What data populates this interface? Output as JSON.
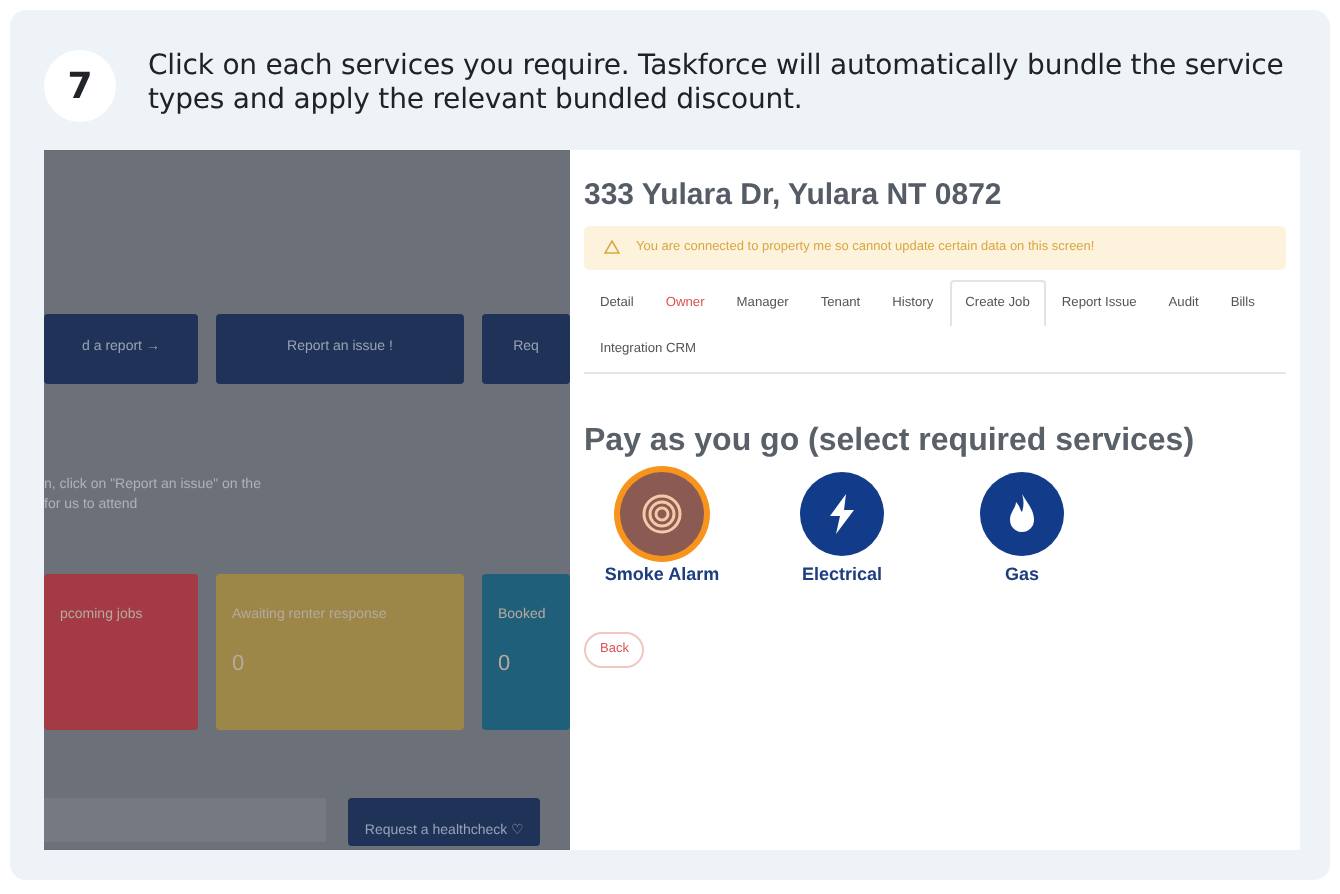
{
  "step": {
    "number": "7",
    "instruction": "Click on each services you require. Taskforce will automatically bundle the service types and apply the relevant bundled discount."
  },
  "background_page": {
    "buttons": [
      {
        "label": "d a report →"
      },
      {
        "label": "Report an issue !"
      },
      {
        "label": "Req"
      }
    ],
    "text_lines": [
      "n, click on \"Report an issue\" on the",
      "for us to attend"
    ],
    "stat_cards": [
      {
        "label": "pcoming jobs",
        "color": "#a33a44"
      },
      {
        "label": "Awaiting renter response",
        "value": "0",
        "color": "#9c8748"
      },
      {
        "label": "Booked",
        "value": "0",
        "color": "#1f5f7a"
      }
    ],
    "healthcheck_button": "Request a healthcheck ♡"
  },
  "property": {
    "title": "333 Yulara Dr, Yulara NT 0872",
    "alert": "You are connected to property me so cannot update certain data on this screen!",
    "tabs": [
      {
        "label": "Detail",
        "selected": false,
        "highlighted": false
      },
      {
        "label": "Owner",
        "selected": false,
        "highlighted": true
      },
      {
        "label": "Manager",
        "selected": false,
        "highlighted": false
      },
      {
        "label": "Tenant",
        "selected": false,
        "highlighted": false
      },
      {
        "label": "History",
        "selected": false,
        "highlighted": false
      },
      {
        "label": "Create Job",
        "selected": true,
        "highlighted": false
      },
      {
        "label": "Report Issue",
        "selected": false,
        "highlighted": false
      },
      {
        "label": "Audit",
        "selected": false,
        "highlighted": false
      },
      {
        "label": "Bills",
        "selected": false,
        "highlighted": false
      },
      {
        "label": "Integration CRM",
        "selected": false,
        "highlighted": false
      }
    ],
    "section_title": "Pay as you go (select required services)",
    "services": [
      {
        "kind": "smoke",
        "label": "Smoke Alarm",
        "selected": true
      },
      {
        "kind": "electrical",
        "label": "Electrical",
        "selected": false
      },
      {
        "kind": "gas",
        "label": "Gas",
        "selected": false
      }
    ],
    "back_button": "Back"
  }
}
